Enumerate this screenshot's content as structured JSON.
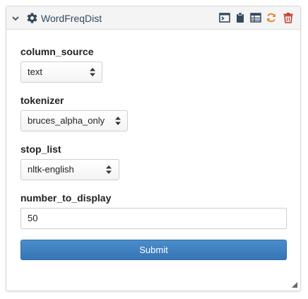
{
  "panel": {
    "title": "WordFreqDist",
    "icons": {
      "collapse": "chevron-down-icon",
      "settings": "gear-icon",
      "toolbar": [
        "terminal-icon",
        "clipboard-icon",
        "table-icon",
        "refresh-icon",
        "trash-icon"
      ]
    }
  },
  "fields": {
    "column_source": {
      "label": "column_source",
      "value": "text"
    },
    "tokenizer": {
      "label": "tokenizer",
      "value": "bruces_alpha_only"
    },
    "stop_list": {
      "label": "stop_list",
      "value": "nltk-english"
    },
    "number_to_display": {
      "label": "number_to_display",
      "value": "50"
    }
  },
  "submit_label": "Submit",
  "colors": {
    "accent": "#337ab7",
    "refresh": "#e67e22",
    "trash": "#c0392b",
    "title": "#34495e"
  }
}
